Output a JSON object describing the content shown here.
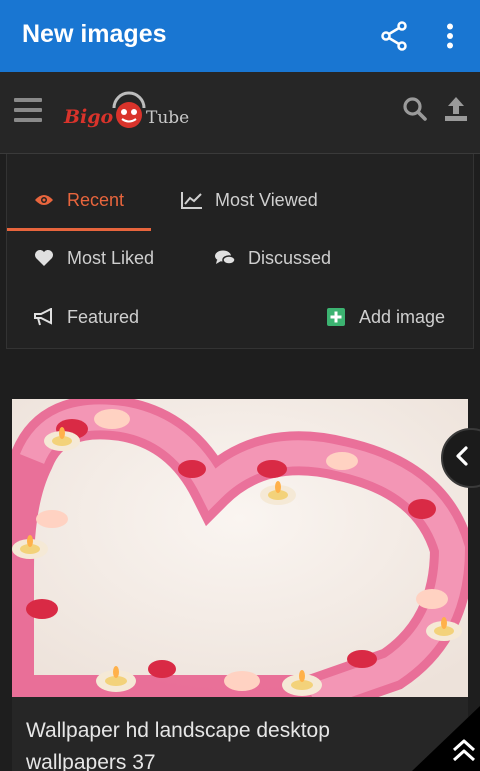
{
  "appbar": {
    "title": "New images",
    "icons": [
      "share-icon",
      "more-vert-icon"
    ]
  },
  "site_header": {
    "logo": {
      "left_text": "Bigo",
      "right_text": "Tube"
    },
    "icons": [
      "hamburger-icon",
      "search-icon",
      "upload-icon"
    ]
  },
  "tabs": {
    "recent": "Recent",
    "most_viewed": "Most Viewed",
    "most_liked": "Most Liked",
    "discussed": "Discussed",
    "featured": "Featured",
    "add_image": "Add image"
  },
  "colors": {
    "appbar": "#1976d2",
    "accent": "#e8653d",
    "add_icon": "#3cb371",
    "background": "#1e1e1e"
  },
  "card": {
    "title": "Wallpaper hd landscape desktop wallpapers 37"
  }
}
